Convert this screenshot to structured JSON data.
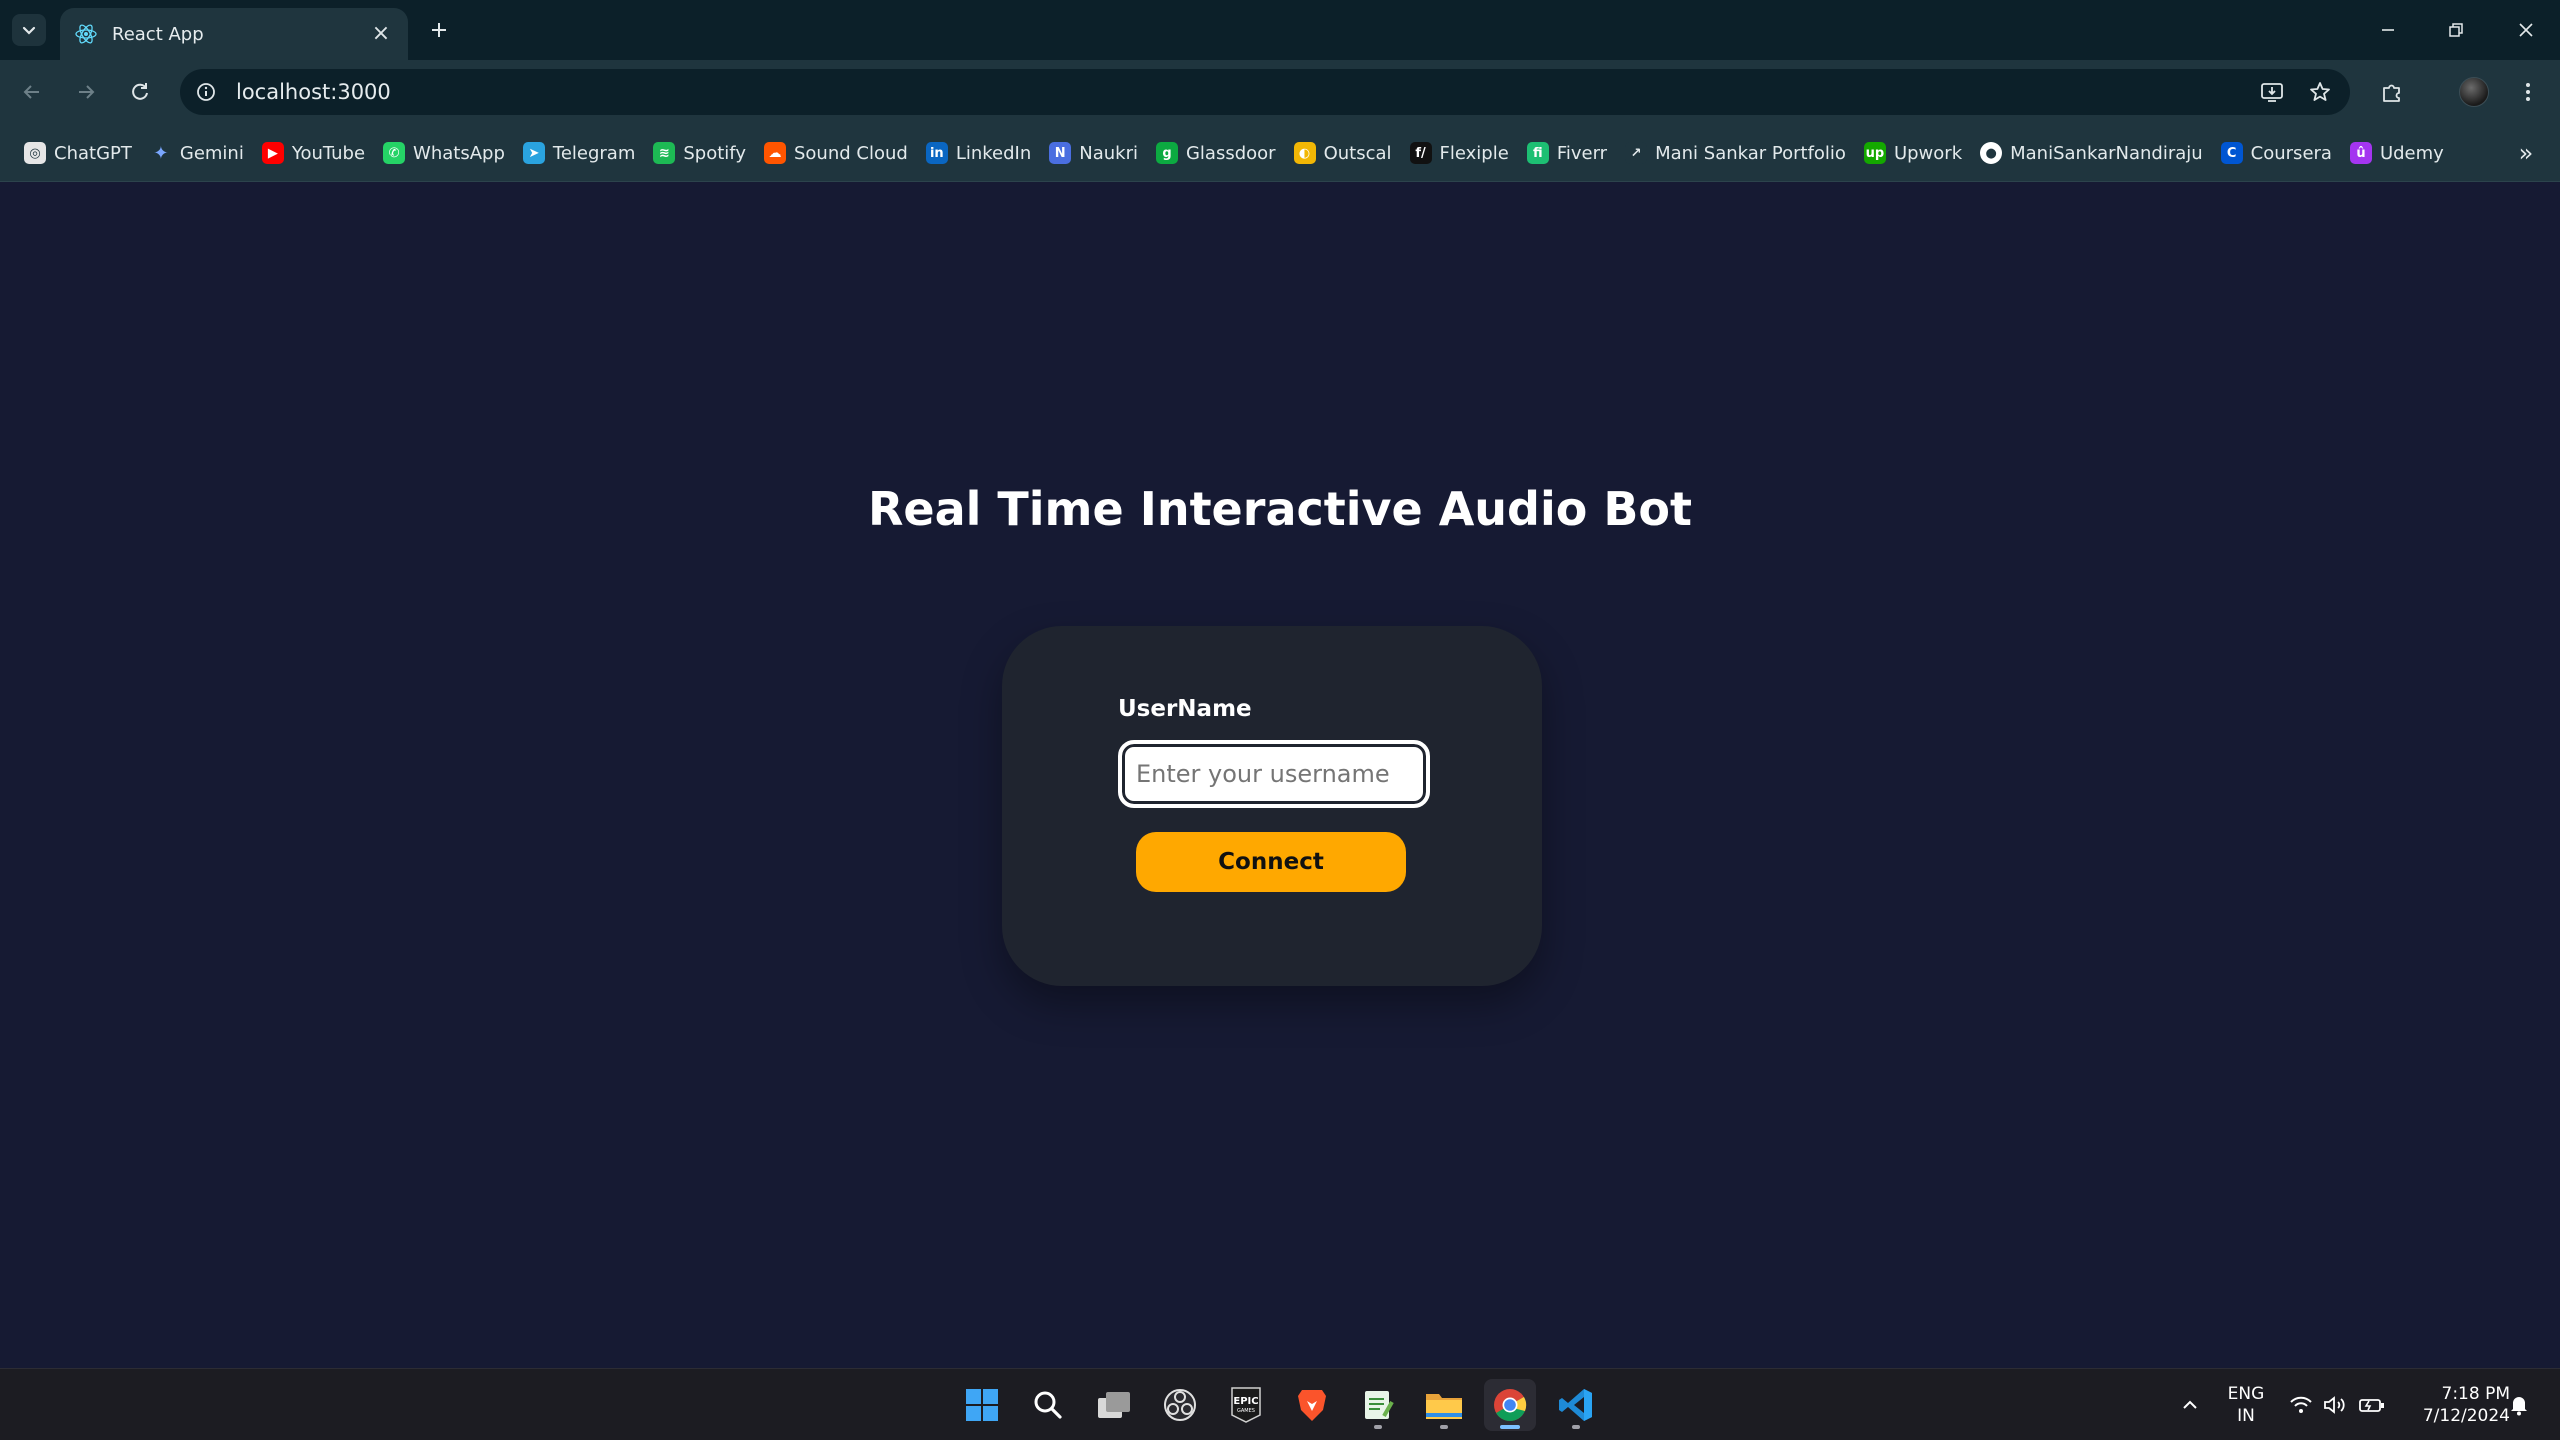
{
  "browser": {
    "tab": {
      "title": "React App",
      "favicon": "react-icon"
    },
    "address_bar": {
      "url": "localhost:3000"
    },
    "bookmarks": [
      {
        "label": "ChatGPT",
        "icon": "chatgpt-icon",
        "color": "#e6e6e6"
      },
      {
        "label": "Gemini",
        "icon": "gemini-icon",
        "color": "#7aa7ff"
      },
      {
        "label": "YouTube",
        "icon": "youtube-icon",
        "color": "#ff0000"
      },
      {
        "label": "WhatsApp",
        "icon": "whatsapp-icon",
        "color": "#25d366"
      },
      {
        "label": "Telegram",
        "icon": "telegram-icon",
        "color": "#2aa3df"
      },
      {
        "label": "Spotify",
        "icon": "spotify-icon",
        "color": "#1db954"
      },
      {
        "label": "Sound Cloud",
        "icon": "soundcloud-icon",
        "color": "#ff5500"
      },
      {
        "label": "LinkedIn",
        "icon": "linkedin-icon",
        "color": "#0a66c2"
      },
      {
        "label": "Naukri",
        "icon": "naukri-icon",
        "color": "#4a6ee0"
      },
      {
        "label": "Glassdoor",
        "icon": "glassdoor-icon",
        "color": "#0caa41"
      },
      {
        "label": "Outscal",
        "icon": "outscal-icon",
        "color": "#f2b705"
      },
      {
        "label": "Flexiple",
        "icon": "flexiple-icon",
        "color": "#111111"
      },
      {
        "label": "Fiverr",
        "icon": "fiverr-icon",
        "color": "#1dbf73"
      },
      {
        "label": "Mani Sankar Portfolio",
        "icon": "portfolio-icon",
        "color": "#1f353e"
      },
      {
        "label": "Upwork",
        "icon": "upwork-icon",
        "color": "#14a800"
      },
      {
        "label": "ManiSankarNandiraju",
        "icon": "github-icon",
        "color": "#1f353e"
      },
      {
        "label": "Coursera",
        "icon": "coursera-icon",
        "color": "#0056d2"
      },
      {
        "label": "Udemy",
        "icon": "udemy-icon",
        "color": "#a435f0"
      }
    ]
  },
  "page": {
    "title": "Real Time Interactive Audio Bot",
    "form": {
      "username_label": "UserName",
      "username_placeholder": "Enter your username",
      "username_value": "",
      "connect_label": "Connect"
    },
    "colors": {
      "background": "#161a33",
      "card": "#1f242f",
      "accent": "#ffa800"
    }
  },
  "taskbar": {
    "apps": [
      "start-icon",
      "search-icon",
      "task-view-icon",
      "obs-icon",
      "epic-games-icon",
      "brave-icon",
      "notepad-icon",
      "file-explorer-icon",
      "chrome-icon",
      "vscode-icon"
    ],
    "language": {
      "line1": "ENG",
      "line2": "IN"
    },
    "clock": {
      "time": "7:18 PM",
      "date": "7/12/2024"
    }
  }
}
